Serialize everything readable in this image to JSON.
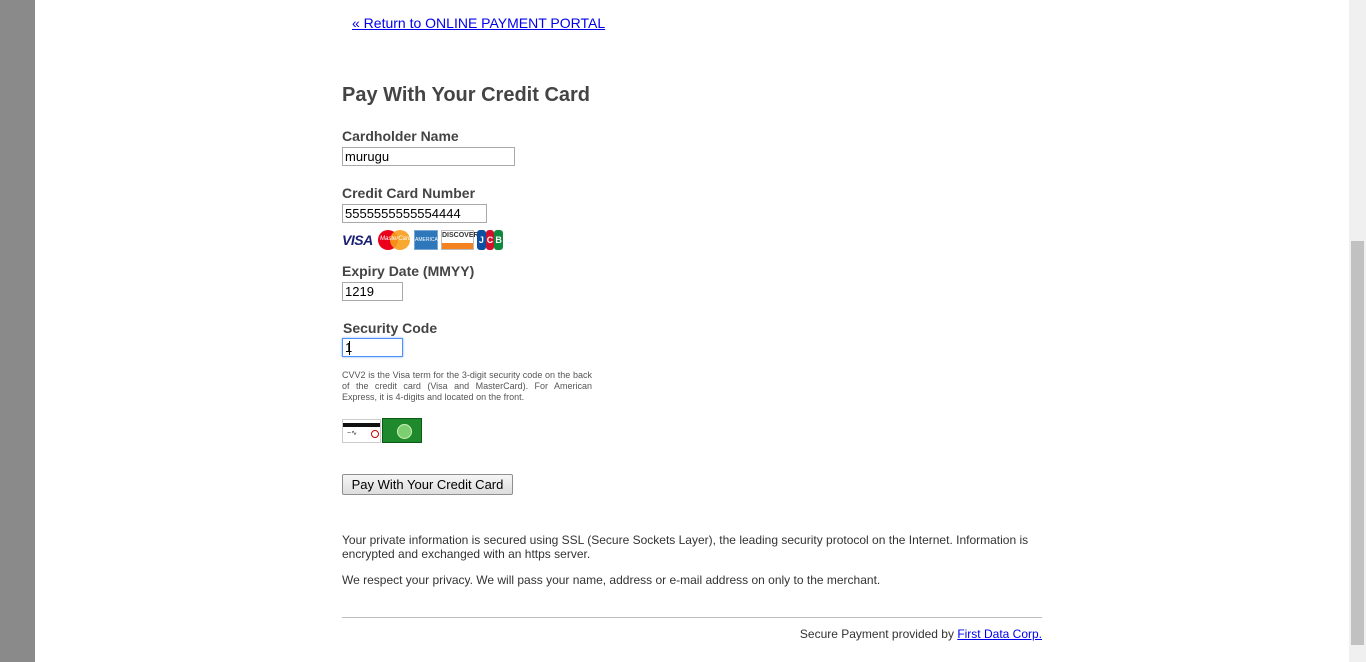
{
  "nav": {
    "return_link": "« Return to ONLINE PAYMENT PORTAL"
  },
  "form": {
    "title": "Pay With Your Credit Card",
    "cardholder": {
      "label": "Cardholder Name",
      "value": "murugu"
    },
    "card_number": {
      "label": "Credit Card Number",
      "value": "5555555555554444"
    },
    "card_logos": {
      "visa": "VISA",
      "mastercard": "MasterCard",
      "amex": "AMERICAN EXPRESS",
      "discover": "DISCOVER",
      "jcb_j": "J",
      "jcb_c": "C",
      "jcb_b": "B"
    },
    "expiry": {
      "label": "Expiry Date (MMYY)",
      "value": "1219"
    },
    "security_code": {
      "label": "Security Code",
      "value": "1",
      "help": "CVV2 is the Visa term for the 3-digit security code on the back of the credit card (Visa and MasterCard). For American Express, it is 4-digits and located on the front."
    },
    "submit_label": "Pay With Your Credit Card"
  },
  "info": {
    "ssl_text": "Your private information is secured using SSL (Secure Sockets Layer), the leading security protocol on the Internet. Information is encrypted and exchanged with an https server.",
    "privacy_text": "We respect your privacy. We will pass your name, address or e-mail address on only to the merchant."
  },
  "footer": {
    "text": "Secure Payment provided by ",
    "link": "First Data Corp."
  },
  "colors": {
    "link": "#0000ee",
    "heading": "#444444",
    "background_outer": "#8a8a8a",
    "focus_border": "#4d90fe"
  }
}
